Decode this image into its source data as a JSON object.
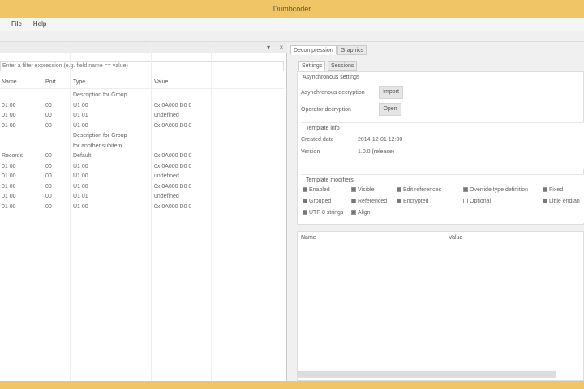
{
  "window": {
    "title": "Dumbcoder"
  },
  "menu": [
    "File",
    "Help"
  ],
  "left": {
    "filter_placeholder": "Enter a filter expression (e.g. field.name == value)",
    "columns": [
      "Name",
      "Port",
      "Type",
      "Value"
    ],
    "rows": [
      {
        "name": "",
        "port": "",
        "type": "Description for Group",
        "value": ""
      },
      {
        "name": "01 00",
        "port": "00",
        "type": "U1 00",
        "value": "0x 0A000 D0 0"
      },
      {
        "name": "01 00",
        "port": "00",
        "type": "U1 01",
        "value": "undefined"
      },
      {
        "name": "01 00",
        "port": "00",
        "type": "U1 00",
        "value": "0x 0A000 D0 0"
      },
      {
        "name": "",
        "port": "",
        "type": "Description for Group",
        "value": ""
      },
      {
        "name": "",
        "port": "",
        "type": "for another subitem",
        "value": ""
      },
      {
        "name": "Records",
        "port": "00",
        "type": "Default",
        "value": "0x 0A000 D0 0"
      },
      {
        "name": "01 00",
        "port": "00",
        "type": "U1 00",
        "value": "0x 0A000 D0 0"
      },
      {
        "name": "01 00",
        "port": "00",
        "type": "U1 00",
        "value": "undefined"
      },
      {
        "name": "01 00",
        "port": "00",
        "type": "U1 00",
        "value": "0x 0A000 D0 0"
      },
      {
        "name": "01 00",
        "port": "00",
        "type": "U1 01",
        "value": "undefined"
      },
      {
        "name": "01 00",
        "port": "00",
        "type": "U1 00",
        "value": "0x 0A000 D0 0"
      }
    ]
  },
  "right": {
    "tabs": [
      "Decompression",
      "Graphics"
    ],
    "subtabs": [
      "Settings",
      "Sessions"
    ],
    "settings": {
      "title": "Asynchronous settings",
      "row1_label": "Asynchronous decryption",
      "row1_button": "Import",
      "row2_label": "Operator decryption",
      "row2_button": "Open"
    },
    "template": {
      "title": "Template info",
      "created_label": "Created date",
      "created_value": "2014-12-01 12:00",
      "version_label": "Version",
      "version_value": "1.0.0 (release)"
    },
    "options": {
      "title": "Template modifiers",
      "items": [
        {
          "label": "Enabled",
          "checked": true
        },
        {
          "label": "Visible",
          "checked": true
        },
        {
          "label": "Edit references",
          "checked": true
        },
        {
          "label": "Override type definition",
          "checked": true
        },
        {
          "label": "Fixed",
          "checked": true
        },
        {
          "label": "Grouped",
          "checked": true
        },
        {
          "label": "Referenced",
          "checked": true
        },
        {
          "label": "Encrypted",
          "checked": true
        },
        {
          "label": "Optional",
          "checked": false
        },
        {
          "label": "Little endian",
          "checked": true
        },
        {
          "label": "UTF-8 strings",
          "checked": true
        },
        {
          "label": "Align",
          "checked": true
        }
      ]
    },
    "list_columns": [
      "Name",
      "Value"
    ]
  }
}
